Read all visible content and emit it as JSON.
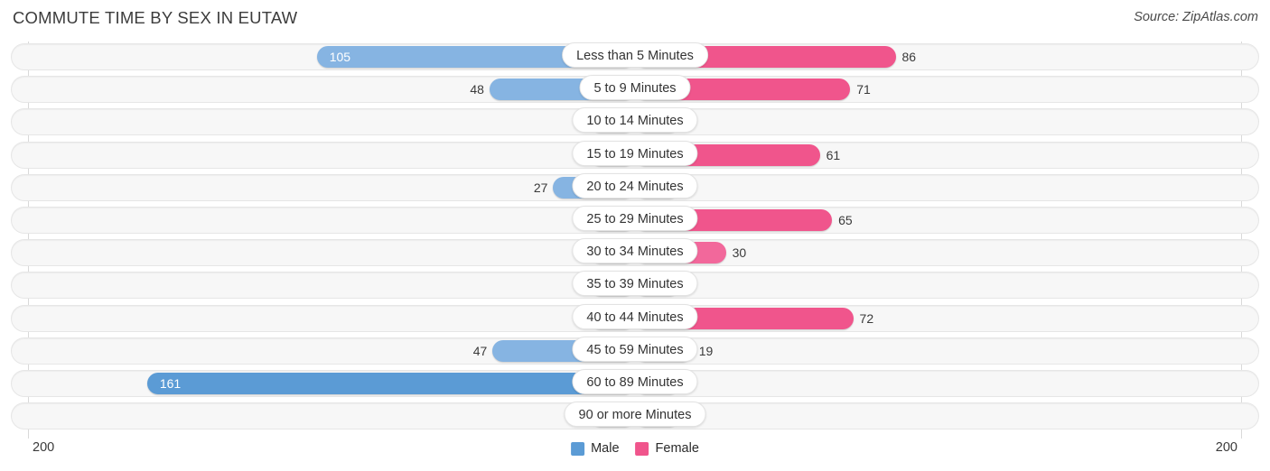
{
  "header": {
    "title": "COMMUTE TIME BY SEX IN EUTAW",
    "source": "Source: ZipAtlas.com"
  },
  "axis": {
    "left_max_label": "200",
    "right_max_label": "200"
  },
  "legend": {
    "items": [
      {
        "label": "Male",
        "color": "#5b9bd5"
      },
      {
        "label": "Female",
        "color": "#f0558c"
      }
    ]
  },
  "chart_data": {
    "type": "bar",
    "orientation": "horizontal-diverging",
    "title": "COMMUTE TIME BY SEX IN EUTAW",
    "xlabel": "",
    "ylabel": "",
    "xlim": [
      200,
      200
    ],
    "axis_max": 200,
    "grid": true,
    "legend_position": "bottom-center",
    "categories": [
      "Less than 5 Minutes",
      "5 to 9 Minutes",
      "10 to 14 Minutes",
      "15 to 19 Minutes",
      "20 to 24 Minutes",
      "25 to 29 Minutes",
      "30 to 34 Minutes",
      "35 to 39 Minutes",
      "40 to 44 Minutes",
      "45 to 59 Minutes",
      "60 to 89 Minutes",
      "90 or more Minutes"
    ],
    "series": [
      {
        "name": "Male",
        "color": "#5b9bd5",
        "side": "left",
        "values": [
          105,
          48,
          0,
          0,
          27,
          0,
          3,
          0,
          0,
          47,
          161,
          0
        ]
      },
      {
        "name": "Female",
        "color": "#f0558c",
        "side": "right",
        "values": [
          86,
          71,
          0,
          61,
          0,
          65,
          30,
          0,
          72,
          19,
          0,
          0
        ]
      }
    ]
  }
}
